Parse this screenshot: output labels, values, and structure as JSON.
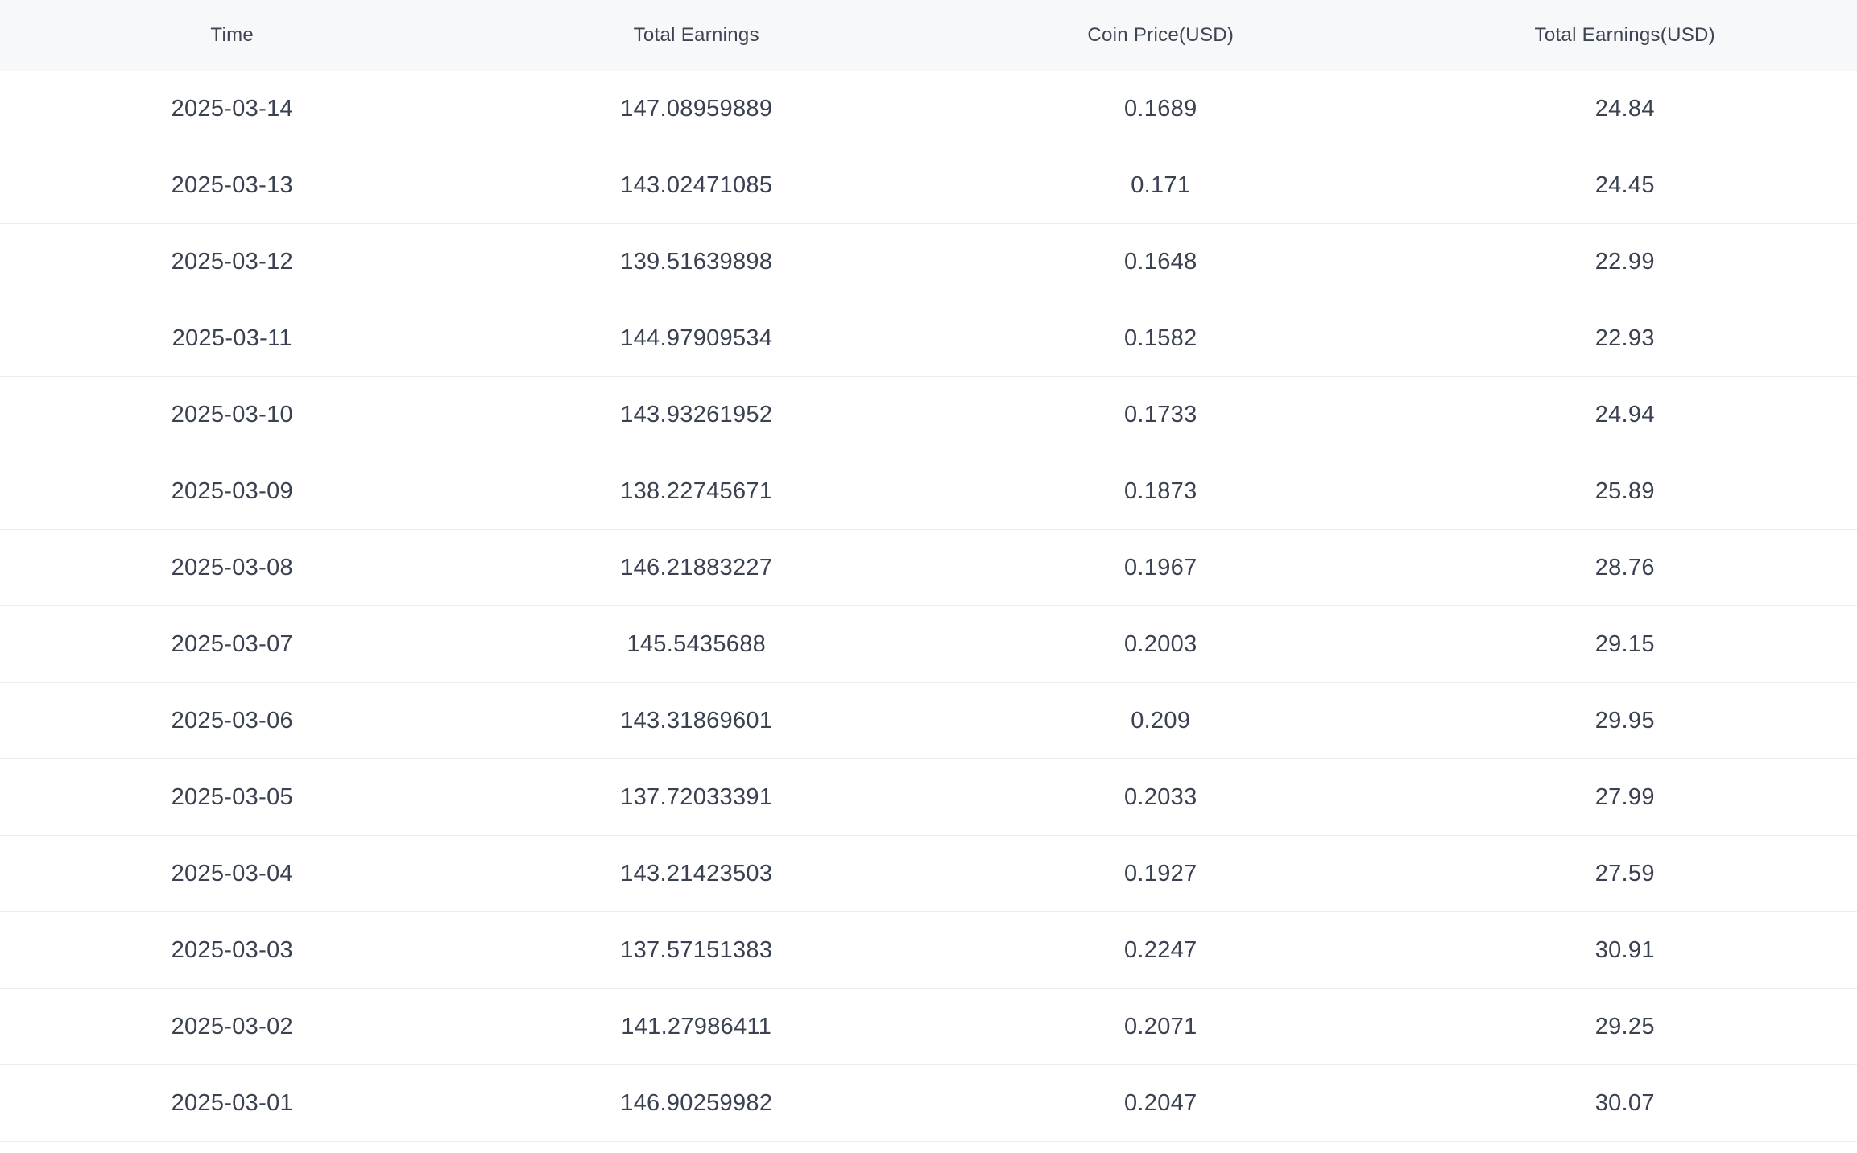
{
  "table": {
    "headers": [
      "Time",
      "Total Earnings",
      "Coin Price(USD)",
      "Total Earnings(USD)"
    ],
    "rows": [
      [
        "2025-03-14",
        "147.08959889",
        "0.1689",
        "24.84"
      ],
      [
        "2025-03-13",
        "143.02471085",
        "0.171",
        "24.45"
      ],
      [
        "2025-03-12",
        "139.51639898",
        "0.1648",
        "22.99"
      ],
      [
        "2025-03-11",
        "144.97909534",
        "0.1582",
        "22.93"
      ],
      [
        "2025-03-10",
        "143.93261952",
        "0.1733",
        "24.94"
      ],
      [
        "2025-03-09",
        "138.22745671",
        "0.1873",
        "25.89"
      ],
      [
        "2025-03-08",
        "146.21883227",
        "0.1967",
        "28.76"
      ],
      [
        "2025-03-07",
        "145.5435688",
        "0.2003",
        "29.15"
      ],
      [
        "2025-03-06",
        "143.31869601",
        "0.209",
        "29.95"
      ],
      [
        "2025-03-05",
        "137.72033391",
        "0.2033",
        "27.99"
      ],
      [
        "2025-03-04",
        "143.21423503",
        "0.1927",
        "27.59"
      ],
      [
        "2025-03-03",
        "137.57151383",
        "0.2247",
        "30.91"
      ],
      [
        "2025-03-02",
        "141.27986411",
        "0.2071",
        "29.25"
      ],
      [
        "2025-03-01",
        "146.90259982",
        "0.2047",
        "30.07"
      ]
    ]
  },
  "colors": {
    "header_bg": "#f7f8fa",
    "text": "#3a4150",
    "divider": "#ebedf0"
  }
}
